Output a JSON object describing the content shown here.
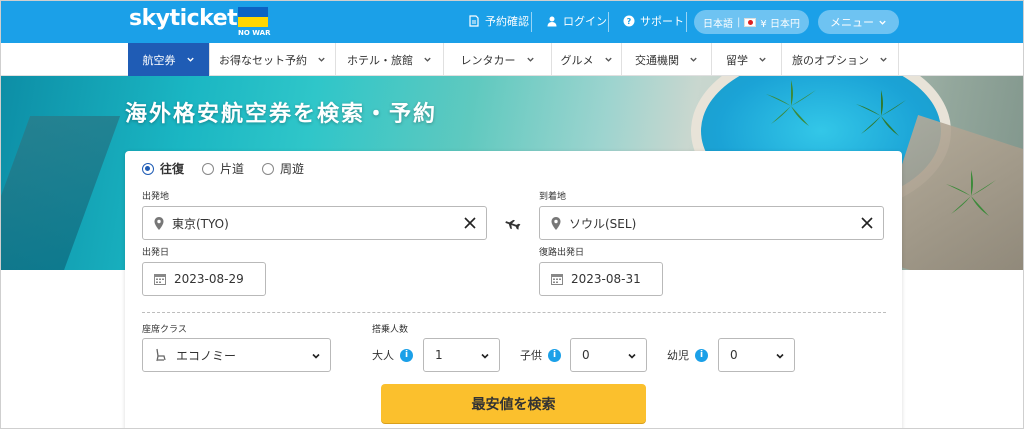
{
  "header": {
    "logo": "skyticket",
    "nowar": "NO WAR",
    "links": [
      "予約確認",
      "ログイン",
      "サポート"
    ],
    "lang_currency": {
      "lang": "日本語",
      "currency": "¥ 日本円"
    },
    "menu_label": "メニュー"
  },
  "nav": {
    "items": [
      "航空券",
      "お得なセット予約",
      "ホテル・旅館",
      "レンタカー",
      "グルメ",
      "交通機関",
      "留学",
      "旅のオプション"
    ]
  },
  "hero": {
    "title": "海外格安航空券を検索・予約"
  },
  "search": {
    "trip_types": [
      "往復",
      "片道",
      "周遊"
    ],
    "selected_trip_type": "往復",
    "origin_label": "出発地",
    "origin_value": "東京(TYO)",
    "destination_label": "到着地",
    "destination_value": "ソウル(SEL)",
    "depart_label": "出発日",
    "depart_value": "2023-08-29",
    "return_label": "復路出発日",
    "return_value": "2023-08-31",
    "cabin_label": "座席クラス",
    "cabin_value": "エコノミー",
    "pax_label": "搭乗人数",
    "adult_label": "大人",
    "adult_value": "1",
    "child_label": "子供",
    "child_value": "0",
    "infant_label": "幼児",
    "infant_value": "0",
    "info_symbol": "i",
    "submit_label": "最安値を検索"
  },
  "colors": {
    "header": "#1ba0e8",
    "nav_active": "#1f5cb5",
    "search_button": "#fbc02d"
  }
}
